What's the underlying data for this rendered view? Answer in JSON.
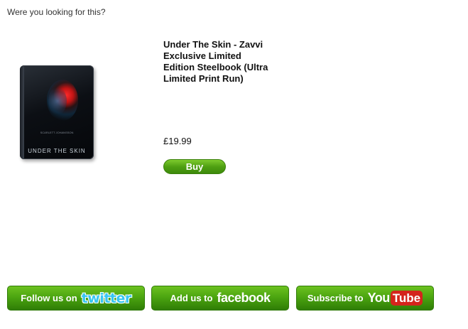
{
  "recommendation": {
    "heading": "Were you looking for this?"
  },
  "product": {
    "title": "Under The Skin - Zavvi Exclusive Limited Edition Steelbook (Ultra Limited Print Run)",
    "price": "£19.99",
    "buy_label": "Buy",
    "image_title": "UNDER THE SKIN",
    "image_credit": "SCARLETT JOHANSSON"
  },
  "social": {
    "twitter": {
      "label": "Follow us on",
      "brand": "twitter"
    },
    "facebook": {
      "label": "Add us to",
      "brand": "facebook"
    },
    "youtube": {
      "label": "Subscribe to",
      "brand_you": "You",
      "brand_tube": "Tube"
    }
  },
  "colors": {
    "button_green": "#4fa012",
    "twitter_blue": "#38c6f2",
    "youtube_red": "#d4241c"
  }
}
